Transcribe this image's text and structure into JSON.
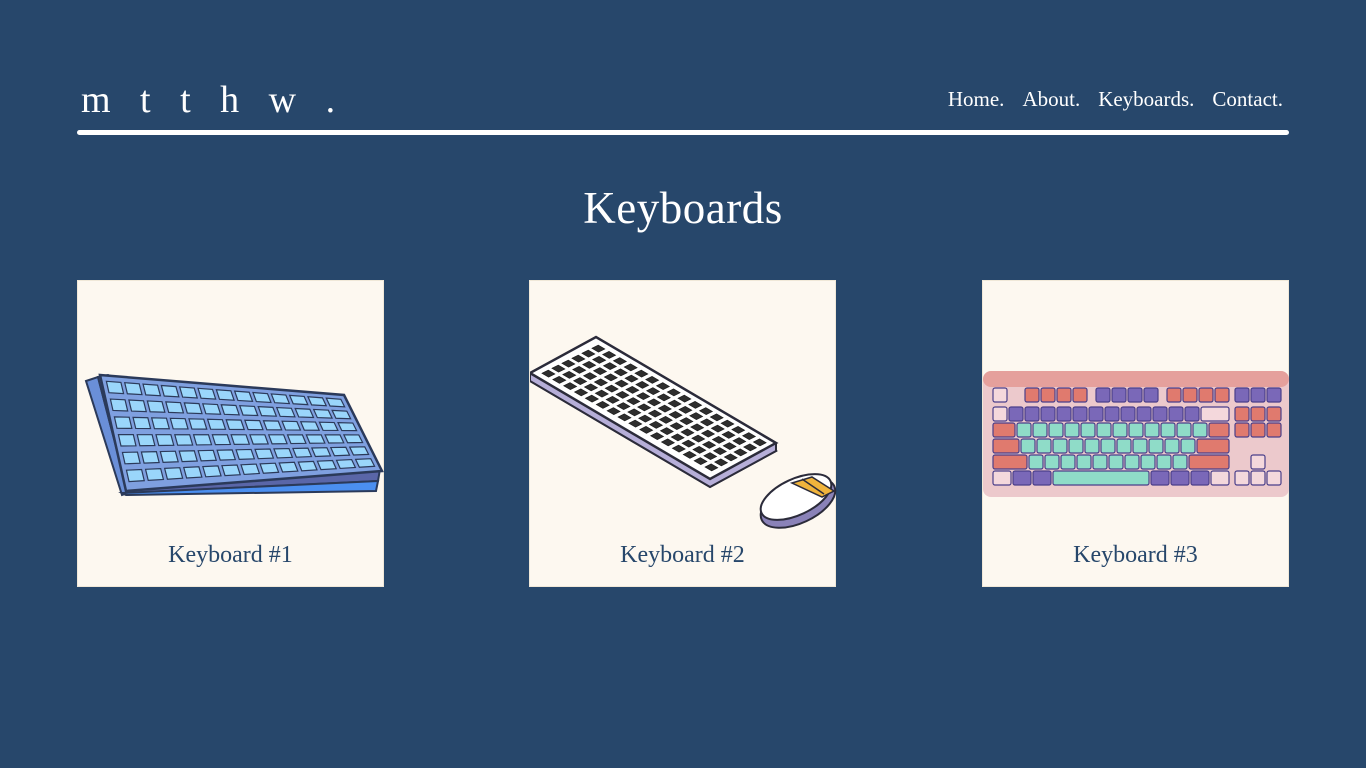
{
  "header": {
    "logo": "m t t h w .",
    "nav": {
      "home": "Home.",
      "about": "About.",
      "keyboards": "Keyboards.",
      "contact": "Contact."
    }
  },
  "main": {
    "title": "Keyboards",
    "cards": [
      {
        "label": "Keyboard #1",
        "illustration": "blue-keyboard-icon"
      },
      {
        "label": "Keyboard #2",
        "illustration": "keyboard-mouse-icon"
      },
      {
        "label": "Keyboard #3",
        "illustration": "pink-keyboard-icon"
      }
    ]
  },
  "colors": {
    "background": "#27476b",
    "card": "#fdf8f0",
    "text_light": "#ffffff",
    "text_dark": "#27476b"
  }
}
